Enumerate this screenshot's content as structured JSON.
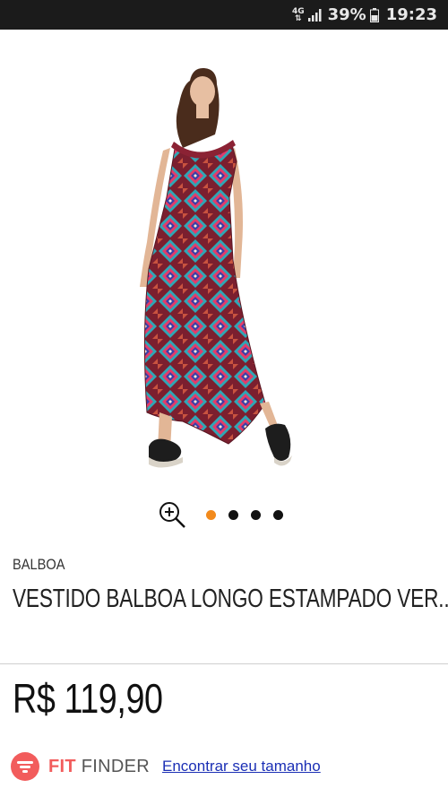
{
  "status_bar": {
    "network": "4G",
    "battery_percent": "39%",
    "time": "19:23"
  },
  "product": {
    "image_icon": "product-photo-dress",
    "brand": "BALBOA",
    "title": "VESTIDO BALBOA LONGO ESTAMPADO VER...",
    "price": "R$ 119,90"
  },
  "gallery": {
    "zoom_icon": "zoom-in-icon",
    "total_images": 4,
    "active_index": 0,
    "active_color": "#f28a1c"
  },
  "fit_finder": {
    "label_part1": "FIT",
    "label_part2": "FINDER",
    "link": "Encontrar seu tamanho",
    "brand_color": "#f25c5c"
  }
}
